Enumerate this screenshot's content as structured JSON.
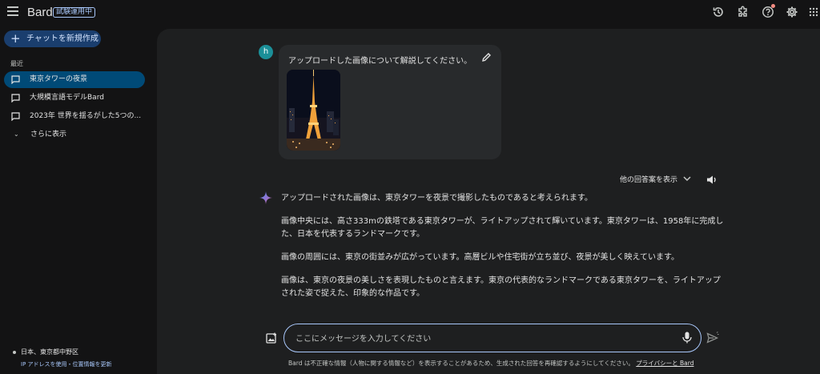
{
  "header": {
    "brand": "Bard",
    "badge": "試験運用中",
    "icons": [
      "history-icon",
      "extensions-icon",
      "help-icon",
      "settings-icon",
      "apps-grid-icon"
    ]
  },
  "sidebar": {
    "new_chat": "チャットを新規作成",
    "recent_label": "最近",
    "items": [
      {
        "label": "東京タワーの夜景",
        "active": true
      },
      {
        "label": "大規模言語モデルBard",
        "active": false
      },
      {
        "label": "2023年 世界を揺るがした5つの...",
        "active": false
      }
    ],
    "show_more": "さらに表示",
    "location": "日本、東京都中野区",
    "location_link": "IP アドレスを使用・位置情報を更新"
  },
  "conversation": {
    "avatar_letter": "h",
    "user_prompt": "アップロードした画像について解説してください。",
    "drafts_label": "他の回答案を表示",
    "answer_paragraphs": [
      "アップロードされた画像は、東京タワーを夜景で撮影したものであると考えられます。",
      "画像中央には、高さ333mの鉄塔である東京タワーが、ライトアップされて輝いています。東京タワーは、1958年に完成した、日本を代表するランドマークです。",
      "画像の周囲には、東京の街並みが広がっています。高層ビルや住宅街が立ち並び、夜景が美しく映えています。",
      "画像は、東京の夜景の美しさを表現したものと言えます。東京の代表的なランドマークである東京タワーを、ライトアップされた姿で捉えた、印象的な作品です。"
    ]
  },
  "composer": {
    "placeholder": "ここにメッセージを入力してください",
    "disclaimer": "Bard は不正確な情報（人物に関する情報など）を表示することがあるため、生成された回答を再確認するようにしてください。",
    "privacy_link": "プライバシーと Bard"
  },
  "colors": {
    "background": "#131314",
    "panel": "#1e1f20",
    "accent": "#a8c7fa",
    "active_item": "#004a77",
    "new_chat_button": "#1a3e6e",
    "avatar": "#1b8f98"
  }
}
